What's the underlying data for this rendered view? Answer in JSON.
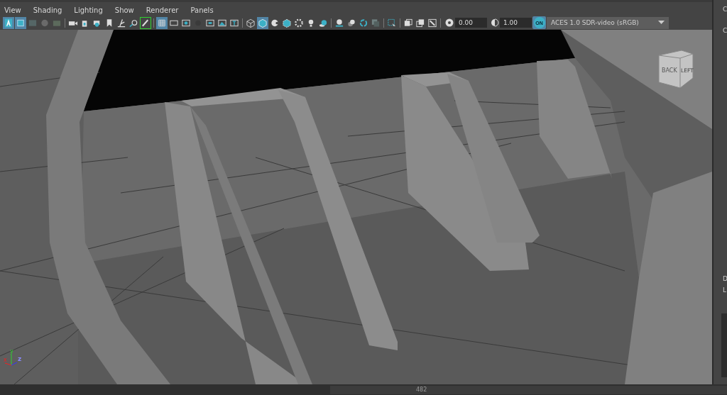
{
  "menu": [
    "View",
    "Shading",
    "Lighting",
    "Show",
    "Renderer",
    "Panels"
  ],
  "toolbar_buttons": [
    {
      "selected": true
    },
    {
      "selected": true
    },
    {
      "selected": false
    },
    {
      "selected": false
    },
    {
      "selected": false
    },
    {
      "selected": false
    },
    {
      "selected": false
    },
    {
      "selected": false
    },
    {
      "selected": false
    },
    {
      "selected": false
    },
    {
      "selected": false
    },
    {
      "selected": true
    },
    {
      "selected": true
    },
    {
      "selected": false
    },
    {
      "selected": false
    },
    {
      "selected": false
    },
    {
      "selected": false
    },
    {
      "selected": false
    },
    {
      "selected": false
    },
    {
      "selected": false
    },
    {
      "selected": true
    },
    {
      "selected": false
    },
    {
      "selected": false
    },
    {
      "selected": false
    },
    {
      "selected": false
    },
    {
      "selected": false
    },
    {
      "selected": false
    },
    {
      "selected": false
    },
    {
      "selected": false
    },
    {
      "selected": false
    },
    {
      "selected": false
    },
    {
      "selected": false
    },
    {
      "selected": false
    },
    {
      "selected": false
    }
  ],
  "exposure": {
    "value": "0.00"
  },
  "gamma": {
    "value": "1.00"
  },
  "color_management": {
    "label": "ON",
    "on": true
  },
  "view_transform": {
    "value": "ACES 1.0 SDR-video (sRGB)"
  },
  "view_cube": {
    "front": "BACK",
    "side": "LEFT"
  },
  "axes": {
    "x": "x",
    "y": "y",
    "z": "z"
  },
  "side_panel": {
    "labels": [
      "C",
      "C",
      "D",
      "L"
    ]
  },
  "status_bar": {
    "value": "482"
  }
}
